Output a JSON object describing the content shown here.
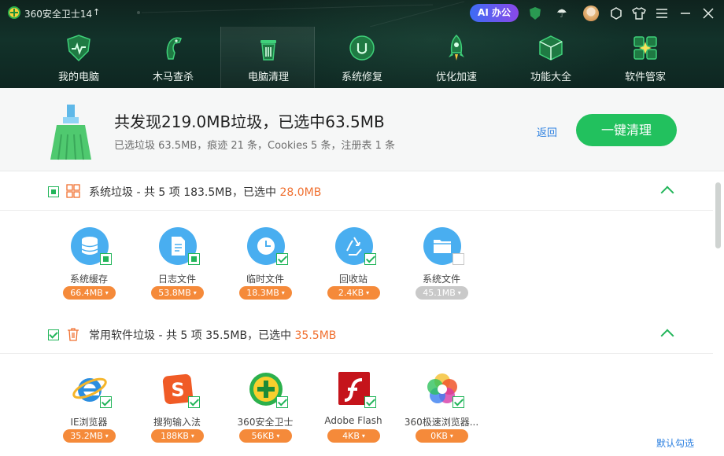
{
  "app": {
    "title": "360安全卫士14",
    "up": "🡅",
    "ai_label": "AI 办公"
  },
  "titlebar_icons": [
    "shield-check-icon",
    "umbrella-icon",
    "avatar",
    "puzzle-icon",
    "shirt-icon",
    "menu-icon",
    "minimize-icon",
    "close-icon"
  ],
  "nav": [
    {
      "label": "我的电脑",
      "icon": "shield-heartbeat-icon"
    },
    {
      "label": "木马查杀",
      "icon": "horse-icon"
    },
    {
      "label": "电脑清理",
      "icon": "trash-icon",
      "active": true
    },
    {
      "label": "系统修复",
      "icon": "wrench-circle-icon"
    },
    {
      "label": "优化加速",
      "icon": "rocket-icon"
    },
    {
      "label": "功能大全",
      "icon": "cube-icon"
    },
    {
      "label": "软件管家",
      "icon": "apps-icon"
    }
  ],
  "header": {
    "title": "共发现219.0MB垃圾，已选中63.5MB",
    "subtitle": "已选垃圾 63.5MB，痕迹 21 条，Cookies 5 条，注册表 1 条",
    "back": "返回",
    "clean": "一键清理"
  },
  "sections": [
    {
      "title_prefix": "系统垃圾 - 共 5 项 183.5MB，已选中 ",
      "selected": "28.0MB",
      "items": [
        {
          "label": "系统缓存",
          "size": "66.4MB",
          "icon": "database-icon",
          "check": "partial"
        },
        {
          "label": "日志文件",
          "size": "53.8MB",
          "icon": "document-icon",
          "check": "partial"
        },
        {
          "label": "临时文件",
          "size": "18.3MB",
          "icon": "clock-icon",
          "check": "full"
        },
        {
          "label": "回收站",
          "size": "2.4KB",
          "icon": "recycle-icon",
          "check": "full"
        },
        {
          "label": "系统文件",
          "size": "45.1MB",
          "icon": "folder-icon",
          "check": "none"
        }
      ]
    },
    {
      "title_prefix": "常用软件垃圾 - 共 5 项 35.5MB，已选中 ",
      "selected": "35.5MB",
      "items": [
        {
          "label": "IE浏览器",
          "size": "35.2MB",
          "icon": "ie-icon",
          "check": "full"
        },
        {
          "label": "搜狗输入法",
          "size": "188KB",
          "icon": "sogou-icon",
          "check": "full"
        },
        {
          "label": "360安全卫士",
          "size": "56KB",
          "icon": "360-icon",
          "check": "full"
        },
        {
          "label": "Adobe Flash",
          "size": "4KB",
          "icon": "flash-icon",
          "check": "full"
        },
        {
          "label": "360极速浏览器...",
          "size": "0KB",
          "icon": "360-browser-icon",
          "check": "full"
        }
      ]
    }
  ],
  "default_select": "默认勾选",
  "colors": {
    "accent_green": "#22c15e",
    "orange": "#f58a3a",
    "link_blue": "#2a7fe0",
    "icon_blue": "#49aef0"
  }
}
